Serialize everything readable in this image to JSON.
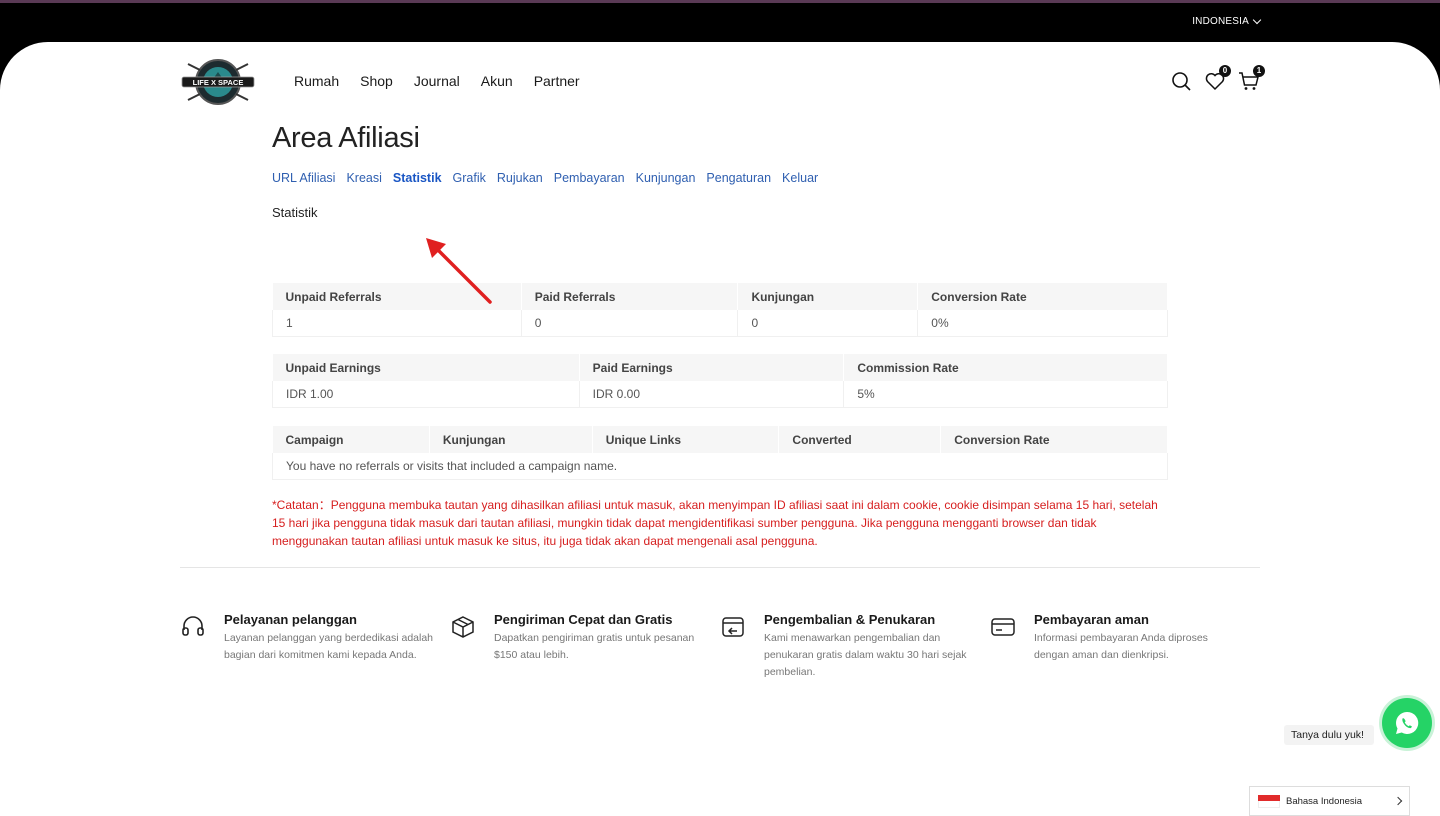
{
  "topbar": {
    "language": "INDONESIA"
  },
  "header": {
    "logo_text": "LIFE X SPACE",
    "nav": [
      "Rumah",
      "Shop",
      "Journal",
      "Akun",
      "Partner"
    ],
    "wishlist_count": "0",
    "cart_count": "1"
  },
  "main": {
    "title": "Area Afiliasi",
    "tabs": [
      "URL Afiliasi",
      "Kreasi",
      "Statistik",
      "Grafik",
      "Rujukan",
      "Pembayaran",
      "Kunjungan",
      "Pengaturan",
      "Keluar"
    ],
    "active_tab": "Statistik",
    "section_title": "Statistik",
    "table_referrals": {
      "headers": [
        "Unpaid Referrals",
        "Paid Referrals",
        "Kunjungan",
        "Conversion Rate"
      ],
      "values": [
        "1",
        "0",
        "0",
        "0%"
      ]
    },
    "table_earnings": {
      "headers": [
        "Unpaid Earnings",
        "Paid Earnings",
        "Commission Rate"
      ],
      "values": [
        "IDR 1.00",
        "IDR 0.00",
        "5%"
      ]
    },
    "table_campaigns": {
      "headers": [
        "Campaign",
        "Kunjungan",
        "Unique Links",
        "Converted",
        "Conversion Rate"
      ],
      "empty_message": "You have no referrals or visits that included a campaign name."
    },
    "note": "*Catatan：Pengguna membuka tautan yang dihasilkan afiliasi untuk masuk, akan menyimpan ID afiliasi saat ini dalam cookie, cookie disimpan selama 15 hari, setelah 15 hari jika pengguna tidak masuk dari tautan afiliasi, mungkin tidak dapat mengidentifikasi sumber pengguna. Jika pengguna mengganti browser dan tidak menggunakan tautan afiliasi untuk masuk ke situs, itu juga tidak akan dapat mengenali asal pengguna."
  },
  "features": [
    {
      "icon": "headset-icon",
      "title": "Pelayanan pelanggan",
      "desc": "Layanan pelanggan yang berdedikasi adalah bagian dari komitmen kami kepada Anda."
    },
    {
      "icon": "box-icon",
      "title": "Pengiriman Cepat dan Gratis",
      "desc": "Dapatkan pengiriman gratis untuk pesanan $150 atau lebih."
    },
    {
      "icon": "return-icon",
      "title": "Pengembalian & Penukaran",
      "desc": "Kami menawarkan pengembalian dan penukaran gratis dalam waktu 30 hari sejak pembelian."
    },
    {
      "icon": "credit-card-icon",
      "title": "Pembayaran aman",
      "desc": "Informasi pembayaran Anda diproses dengan aman dan dienkripsi."
    }
  ],
  "whatsapp": {
    "tooltip": "Tanya dulu yuk!"
  },
  "language_switcher": {
    "label": "Bahasa Indonesia"
  },
  "colors": {
    "link": "#2f5fb0",
    "note": "#d61f1f",
    "whatsapp": "#25d366"
  }
}
